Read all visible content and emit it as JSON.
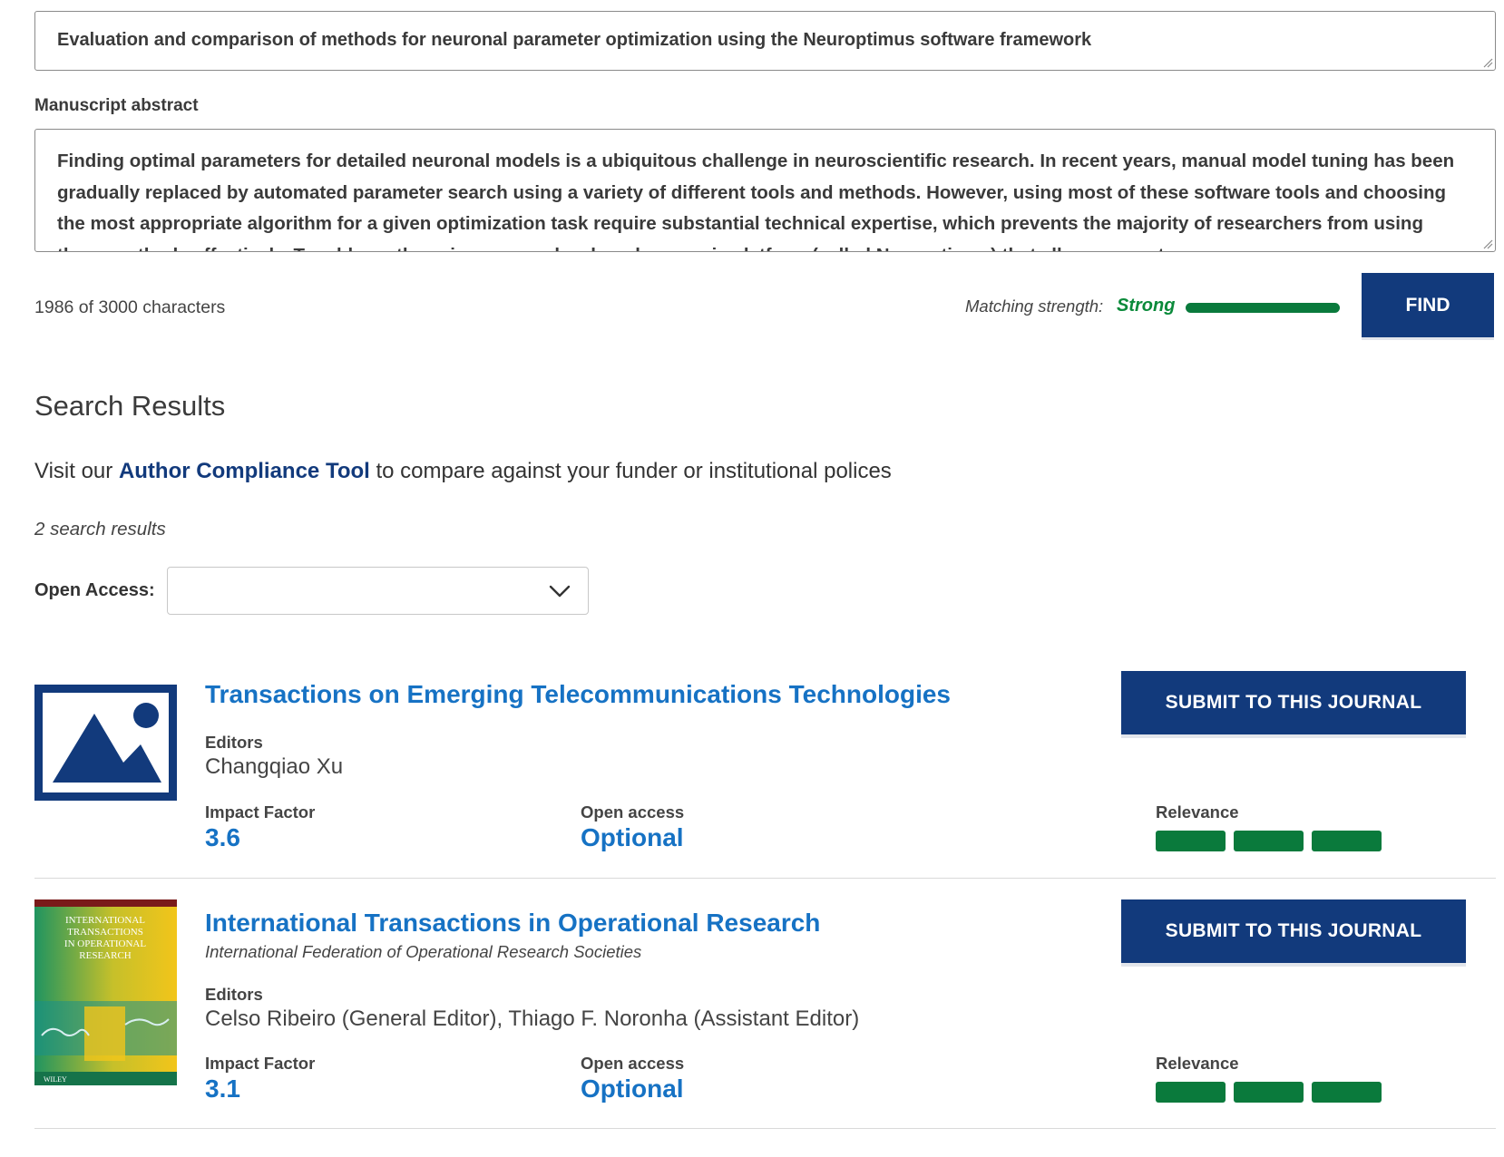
{
  "manuscript": {
    "title": "Evaluation and comparison of methods for neuronal parameter optimization using the Neuroptimus software framework",
    "abstract_label": "Manuscript abstract",
    "abstract": "Finding optimal parameters for detailed neuronal models is a ubiquitous challenge in neuroscientific research. In recent years, manual model tuning has been gradually replaced by automated parameter search using a variety of different tools and methods. However, using most of these software tools and choosing the most appropriate algorithm for a given optimization task require substantial technical expertise, which prevents the majority of researchers from using these methods effectively. To address these issues, we developed a generic platform (called Neuroptimus) that allows users to",
    "char_count": "1986 of 3000 characters"
  },
  "matching": {
    "label": "Matching strength:",
    "value": "Strong",
    "color": "#0a8a3a"
  },
  "find_label": "FIND",
  "results": {
    "title": "Search Results",
    "compliance_prefix": "Visit our ",
    "compliance_link": "Author Compliance Tool",
    "compliance_suffix": " to compare against your funder or institutional polices",
    "count": "2 search results",
    "open_access_label": "Open Access:",
    "open_access_value": ""
  },
  "journals": [
    {
      "name": "Transactions on Emerging Telecommunications Technologies",
      "society": "",
      "editors_label": "Editors",
      "editors": "Changqiao Xu",
      "impact_label": "Impact Factor",
      "impact": "3.6",
      "oa_label": "Open access",
      "oa": "Optional",
      "relevance_label": "Relevance",
      "relevance_bars": 3,
      "submit_label": "SUBMIT TO THIS JOURNAL",
      "thumbnail": "image-placeholder-icon"
    },
    {
      "name": "International Transactions in Operational Research",
      "society": "International Federation of Operational Research Societies",
      "editors_label": "Editors",
      "editors": "Celso Ribeiro (General Editor), Thiago F. Noronha (Assistant Editor)",
      "impact_label": "Impact Factor",
      "impact": "3.1",
      "oa_label": "Open access",
      "oa": "Optional",
      "relevance_label": "Relevance",
      "relevance_bars": 3,
      "submit_label": "SUBMIT TO THIS JOURNAL",
      "thumbnail": "journal-cover",
      "cover": {
        "title_lines": [
          "INTERNATIONAL",
          "TRANSACTIONS",
          "IN OPERATIONAL",
          "RESEARCH"
        ],
        "publisher": "WILEY"
      }
    }
  ],
  "colors": {
    "brand_navy": "#123a7c",
    "link_blue": "#1672c4",
    "relevance_green": "#0a7a3c"
  }
}
